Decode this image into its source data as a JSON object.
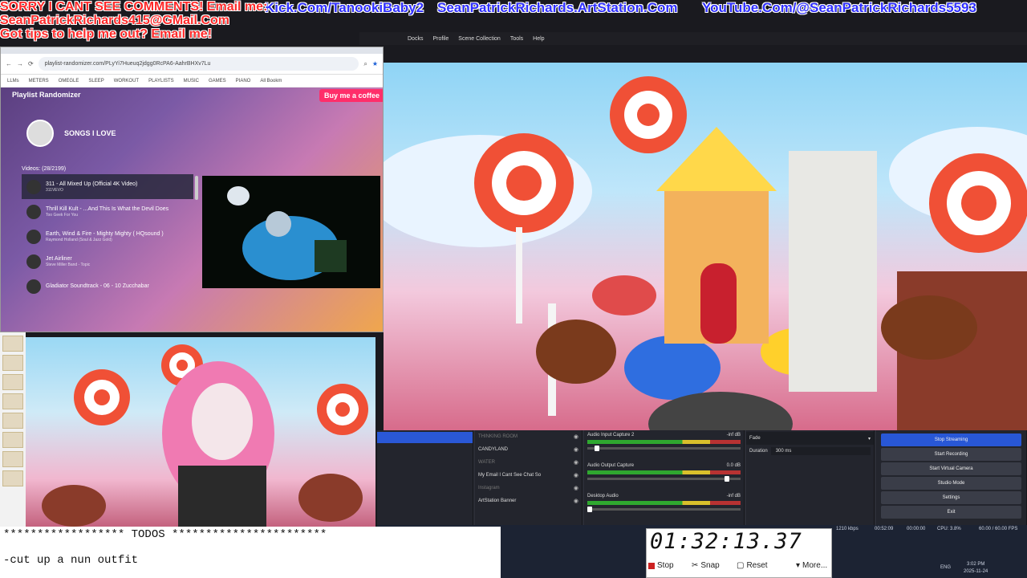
{
  "overlay": {
    "line1": "SORRY I CANT SEE COMMENTS! Email me:",
    "line2": "SeanPatrickRichards415@GMail.Com",
    "line3": "Got tips to help me out? Email me!",
    "kick": "Kick.Com/TanookiBaby2",
    "artstation": "SeanPatrickRichards.ArtStation.Com",
    "youtube": "YouTube.Com/@SeanPatrickRichards5593"
  },
  "obs_menu": [
    "Docks",
    "Profile",
    "Scene Collection",
    "Tools",
    "Help"
  ],
  "browser": {
    "url": "playlist-randomizer.com/PLyYi7Hueuq2jdgg0RcPA6-AahrBHXv7Lu",
    "bookmarks": [
      "LLMs",
      "METERS",
      "OMEGLE",
      "SLEEP",
      "WORKOUT",
      "PLAYLISTS",
      "MUSIC",
      "GAMES",
      "PIANO",
      "All Bookm"
    ]
  },
  "playlist": {
    "app_title": "Playlist Randomizer",
    "coffee": "Buy me a coffee",
    "name": "SONGS I LOVE",
    "count": "Videos: (28/2199)",
    "videos": [
      {
        "title": "311 - All Mixed Up (Official 4K Video)",
        "sub": "311VEVO"
      },
      {
        "title": "Thrill Kill Kult - ...And This Is What the Devil Does",
        "sub": "Too Geek For You"
      },
      {
        "title": "Earth, Wind & Fire - Mighty Mighty ( HQsound )",
        "sub": "Raymond Holland (Soul & Jazz Gold)"
      },
      {
        "title": "Jet Airliner",
        "sub": "Steve Miller Band - Topic"
      },
      {
        "title": "Gladiator Soundtrack - 06 - 10 Zucchabar",
        "sub": ""
      }
    ]
  },
  "scenes": [
    {
      "name": "THINKING ROOM",
      "dim": true
    },
    {
      "name": "CANDYLAND",
      "dim": false
    },
    {
      "name": "WATER",
      "dim": true
    },
    {
      "name": "My Email I Cant See Chat So",
      "dim": false
    },
    {
      "name": "Instagram",
      "dim": true
    },
    {
      "name": "ArtStation Banner",
      "dim": false
    }
  ],
  "mixer": [
    {
      "name": "Audio Input Capture 2",
      "db": "-inf dB",
      "level": 0.05
    },
    {
      "name": "Audio Output Capture",
      "db": "0.0 dB",
      "level": 0.95
    },
    {
      "name": "Desktop Audio",
      "db": "-inf dB",
      "level": 0.0
    }
  ],
  "transition": {
    "type": "Fade",
    "duration_label": "Duration",
    "duration": "300 ms"
  },
  "controls": [
    "Stop Streaming",
    "Start Recording",
    "Start Virtual Camera",
    "Studio Mode",
    "Settings",
    "Exit"
  ],
  "status": {
    "bitrate": "1210 kbps",
    "stream_time": "00:52:09",
    "rec_time": "00:00:00",
    "cpu": "CPU: 3.8%",
    "fps": "60.00 / 60.00 FPS"
  },
  "notepad": "****************** TODOS ***********************\n\n-cut up a nun outfit",
  "stopwatch": {
    "time": "01:32:13.37",
    "stop": "Stop",
    "snap": "Snap",
    "reset": "Reset",
    "more": "More..."
  },
  "tray": {
    "lang": "ENG",
    "time": "3:02 PM",
    "date": "2025-11-24"
  },
  "colors": {
    "overlay_red": "#ff2a2a",
    "overlay_blue": "#2f2fff",
    "obs_active": "#2857d6"
  }
}
